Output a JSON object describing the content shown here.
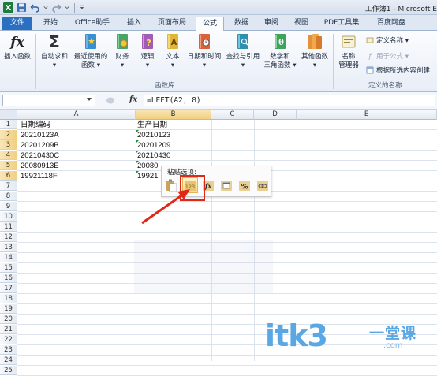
{
  "window": {
    "title": "工作簿1 - Microsoft E"
  },
  "tabs": [
    "文件",
    "开始",
    "Office助手",
    "插入",
    "页面布局",
    "公式",
    "数据",
    "审阅",
    "视图",
    "PDF工具集",
    "百度网盘"
  ],
  "active_tab": "公式",
  "ribbon": {
    "function_library": {
      "label": "函数库",
      "buttons": [
        {
          "label": "插入函数",
          "icon": "fx-icon"
        },
        {
          "label": "自动求和",
          "label2": "▾",
          "icon": "sigma-icon"
        },
        {
          "label": "最近使用的",
          "label2": "函数 ▾",
          "icon": "book-star-icon"
        },
        {
          "label": "财务",
          "label2": "▾",
          "icon": "book-coin-icon"
        },
        {
          "label": "逻辑",
          "label2": "▾",
          "icon": "book-question-icon"
        },
        {
          "label": "文本",
          "label2": "▾",
          "icon": "book-a-icon"
        },
        {
          "label": "日期和时间",
          "label2": "▾",
          "icon": "book-clock-icon"
        },
        {
          "label": "查找与引用",
          "label2": "▾",
          "icon": "book-search-icon"
        },
        {
          "label": "数学和",
          "label2": "三角函数 ▾",
          "icon": "book-theta-icon"
        },
        {
          "label": "其他函数",
          "label2": "▾",
          "icon": "books-icon"
        }
      ]
    },
    "defined_names": {
      "label": "定义的名称",
      "name_manager_label": "名称",
      "name_manager_label2": "管理器",
      "commands": [
        "定义名称 ▾",
        "用于公式 ▾",
        "根据所选内容创建"
      ]
    }
  },
  "formula_bar": {
    "name_box": "",
    "fx_label": "fx",
    "formula": "=LEFT(A2, 8)"
  },
  "grid": {
    "columns": [
      "A",
      "B",
      "C",
      "D",
      "E"
    ],
    "rows": [
      "1",
      "2",
      "3",
      "4",
      "5",
      "6",
      "7",
      "8",
      "9",
      "10",
      "11",
      "12",
      "13",
      "14",
      "15",
      "16",
      "17",
      "18",
      "19",
      "20",
      "21",
      "22",
      "23",
      "24",
      "25"
    ],
    "col_a": [
      "日期编码",
      "20210123A",
      "20201209B",
      "20210430C",
      "20080913E",
      "19921118F"
    ],
    "col_b": [
      "生产日期",
      "20210123",
      "20201209",
      "20210430",
      "20080",
      "19921"
    ]
  },
  "paste_popup": {
    "title": "粘贴选项:",
    "options": [
      {
        "name": "paste-icon"
      },
      {
        "name": "paste-values-icon",
        "label": "123"
      },
      {
        "name": "paste-formulas-icon",
        "label": "fx"
      },
      {
        "name": "paste-formatting-icon"
      },
      {
        "name": "paste-percent-icon",
        "label": "%"
      },
      {
        "name": "paste-link-icon"
      }
    ]
  },
  "watermark": {
    "text": "itk3",
    "cn": "一堂课",
    "com": ".com"
  },
  "colors": {
    "accent_blue": "#2b6fc3",
    "highlight_red": "#e02818",
    "watermark_blue": "#5aa7e6",
    "selected_header": "#f1cf7e"
  }
}
